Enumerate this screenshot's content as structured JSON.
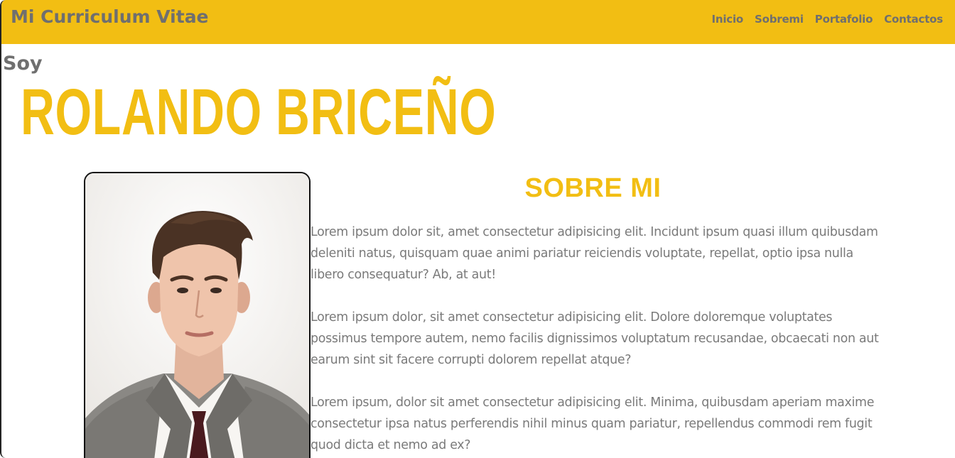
{
  "header": {
    "brand": "Mi Curriculum Vitae",
    "nav": [
      "Inicio",
      "Sobremi",
      "Portafolio",
      "Contactos"
    ]
  },
  "hero": {
    "intro": "Soy",
    "name": "Rolando Briceño"
  },
  "about": {
    "title": "SOBRE MI",
    "paragraphs": [
      "Lorem ipsum dolor sit, amet consectetur adipisicing elit. Incidunt ipsum quasi illum quibusdam deleniti natus, quisquam quae animi pariatur reiciendis voluptate, repellat, optio ipsa nulla libero consequatur? Ab, at aut!",
      "Lorem ipsum dolor, sit amet consectetur adipisicing elit. Dolore doloremque voluptates possimus tempore autem, nemo facilis dignissimos voluptatum recusandae, obcaecati non aut earum sint sit facere corrupti dolorem repellat atque?",
      "Lorem ipsum, dolor sit amet consectetur adipisicing elit. Minima, quibusdam aperiam maxime consectetur ipsa natus perferendis nihil minus quam pariatur, repellendus commodi rem fugit quod dicta et nemo ad ex?"
    ]
  },
  "colors": {
    "accent": "#f2be13",
    "text_gray": "#6f6f6f",
    "body_text": "#7a7a7a"
  }
}
